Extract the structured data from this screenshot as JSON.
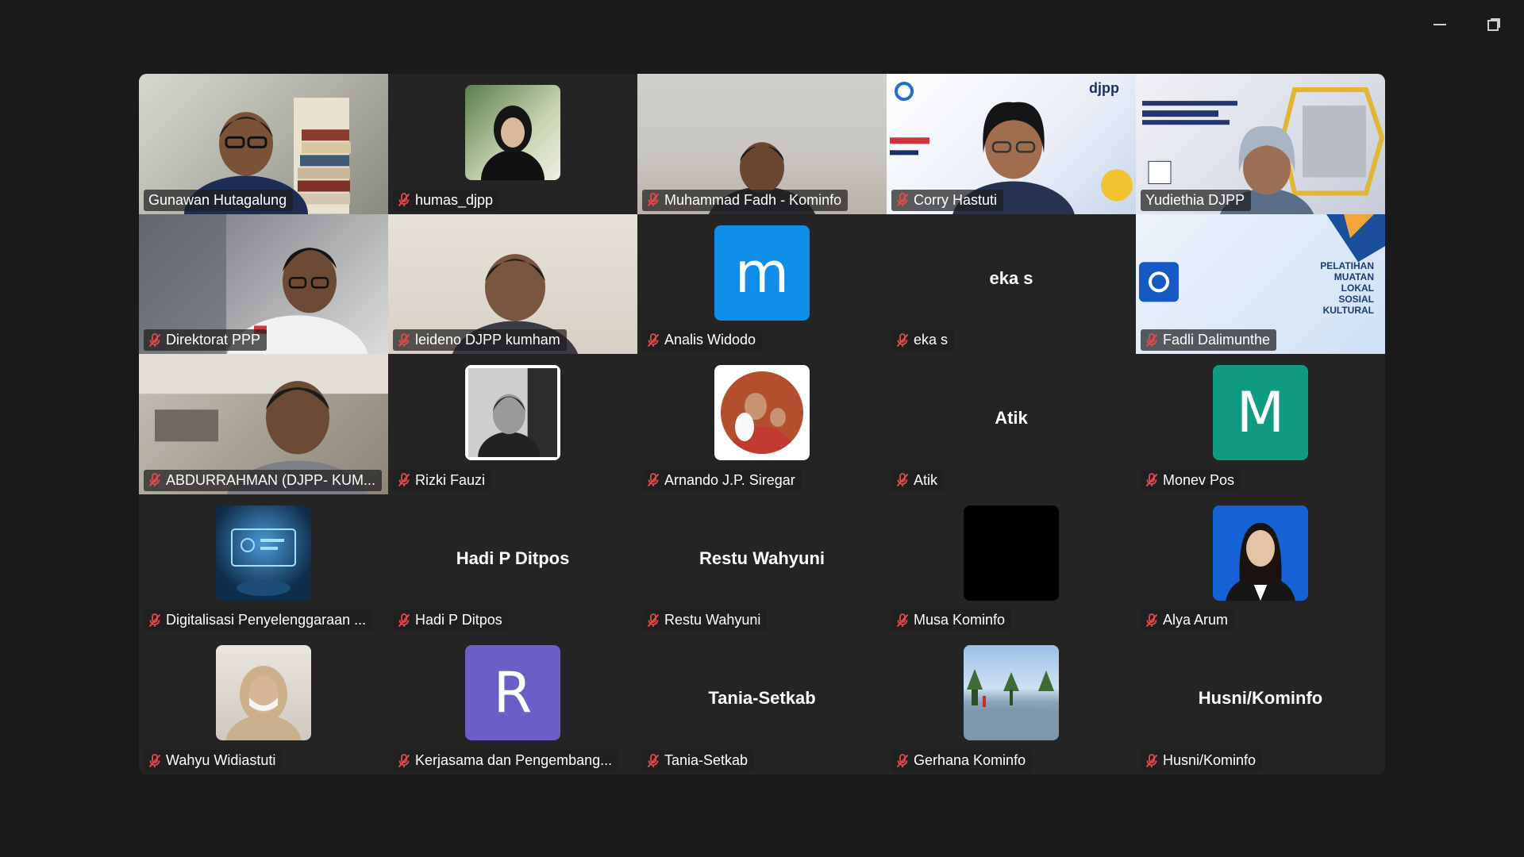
{
  "window": {
    "minimize_label": "",
    "restore_label": ""
  },
  "participants": [
    {
      "name": "Gunawan Hutagalung",
      "muted": false,
      "active": true,
      "kind": "video",
      "scene": "room1"
    },
    {
      "name": "humas_djpp",
      "muted": true,
      "kind": "avatar-photo",
      "photo": "hijab-woman"
    },
    {
      "name": "Muhammad Fadh - Kominfo",
      "muted": true,
      "kind": "video",
      "scene": "room2"
    },
    {
      "name": "Corry Hastuti",
      "muted": true,
      "kind": "video",
      "scene": "djpp"
    },
    {
      "name": "Yudiethia DJPP",
      "muted": false,
      "kind": "video",
      "scene": "peraturan"
    },
    {
      "name": "Direktorat PPP",
      "muted": true,
      "kind": "video",
      "scene": "office"
    },
    {
      "name": "leideno DJPP kumham",
      "muted": true,
      "kind": "video",
      "scene": "cream"
    },
    {
      "name": "Analis Widodo",
      "muted": true,
      "kind": "letter",
      "letter": "m",
      "color": "#0e8ee9"
    },
    {
      "name": "eka s",
      "muted": true,
      "kind": "text",
      "display": "eka s"
    },
    {
      "name": "Fadli Dalimunthe",
      "muted": true,
      "kind": "video",
      "scene": "pelatihan",
      "banner": [
        "PELATIHAN",
        "MUATAN",
        "LOKAL",
        "SOSIAL",
        "KULTURAL"
      ]
    },
    {
      "name": "ABDURRAHMAN (DJPP- KUM...",
      "muted": true,
      "kind": "video",
      "scene": "abdur"
    },
    {
      "name": "Rizki Fauzi",
      "muted": true,
      "kind": "avatar-photo",
      "photo": "bw-portrait"
    },
    {
      "name": "Arnando J.P. Siregar",
      "muted": true,
      "kind": "avatar-photo",
      "photo": "family"
    },
    {
      "name": "Atik",
      "muted": true,
      "kind": "text",
      "display": "Atik"
    },
    {
      "name": "Monev Pos",
      "muted": true,
      "kind": "letter",
      "letter": "M",
      "color": "#0f9b82"
    },
    {
      "name": "Digitalisasi Penyelenggaraan ...",
      "muted": true,
      "kind": "avatar-photo",
      "photo": "tech"
    },
    {
      "name": "Hadi P Ditpos",
      "muted": true,
      "kind": "text",
      "display": "Hadi P Ditpos"
    },
    {
      "name": "Restu Wahyuni",
      "muted": true,
      "kind": "text",
      "display": "Restu Wahyuni"
    },
    {
      "name": "Musa Kominfo",
      "muted": true,
      "kind": "avatar-photo",
      "photo": "black"
    },
    {
      "name": "Alya Arum",
      "muted": true,
      "kind": "avatar-photo",
      "photo": "blue-portrait"
    },
    {
      "name": "Wahyu Widiastuti",
      "muted": true,
      "kind": "avatar-photo",
      "photo": "mask-woman"
    },
    {
      "name": "Kerjasama dan Pengembang...",
      "muted": true,
      "kind": "letter",
      "letter": "R",
      "color": "#6a5fc7"
    },
    {
      "name": "Tania-Setkab",
      "muted": true,
      "kind": "text",
      "display": "Tania-Setkab"
    },
    {
      "name": "Gerhana Kominfo",
      "muted": true,
      "kind": "avatar-photo",
      "photo": "landscape"
    },
    {
      "name": "Husni/Kominfo",
      "muted": true,
      "kind": "text",
      "display": "Husni/Kominfo"
    }
  ],
  "colors": {
    "active_border": "#29c45f",
    "muted_mic": "#e5484d",
    "tile_bg": "#242424"
  }
}
